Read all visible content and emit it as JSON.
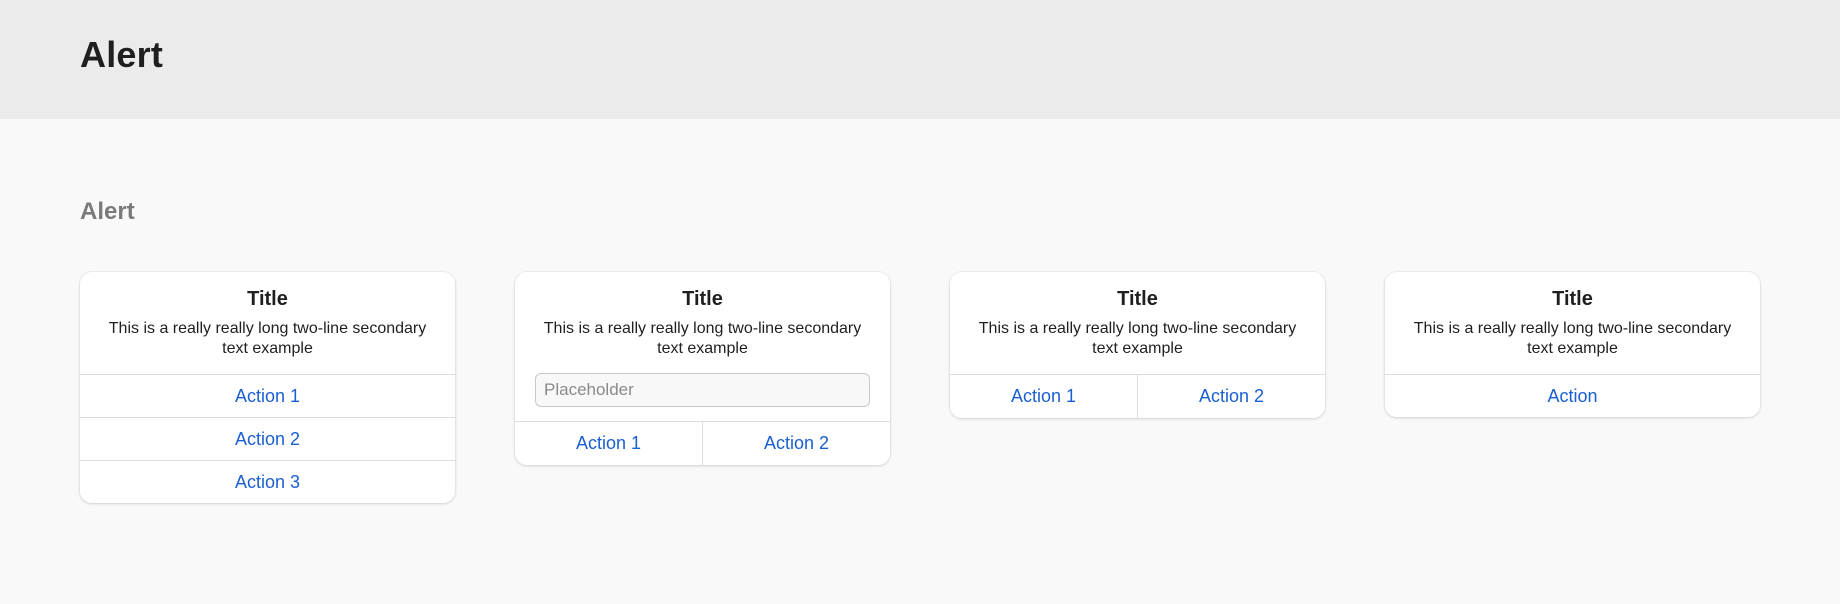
{
  "header": {
    "title": "Alert"
  },
  "section": {
    "title": "Alert"
  },
  "colors": {
    "action_blue": "#1a5fd1",
    "header_bg": "#ebebeb",
    "page_bg": "#f9f9f9"
  },
  "alerts": [
    {
      "title": "Title",
      "message": "This is a really really long two-line secondary text example",
      "actions": [
        "Action 1",
        "Action 2",
        "Action 3"
      ]
    },
    {
      "title": "Title",
      "message": "This is a really really long two-line secondary text example",
      "input_placeholder": "Placeholder",
      "actions": [
        "Action 1",
        "Action 2"
      ]
    },
    {
      "title": "Title",
      "message": "This is a really really long two-line secondary text example",
      "actions": [
        "Action 1",
        "Action 2"
      ]
    },
    {
      "title": "Title",
      "message": "This is a really really long two-line secondary text example",
      "actions": [
        "Action"
      ]
    }
  ]
}
